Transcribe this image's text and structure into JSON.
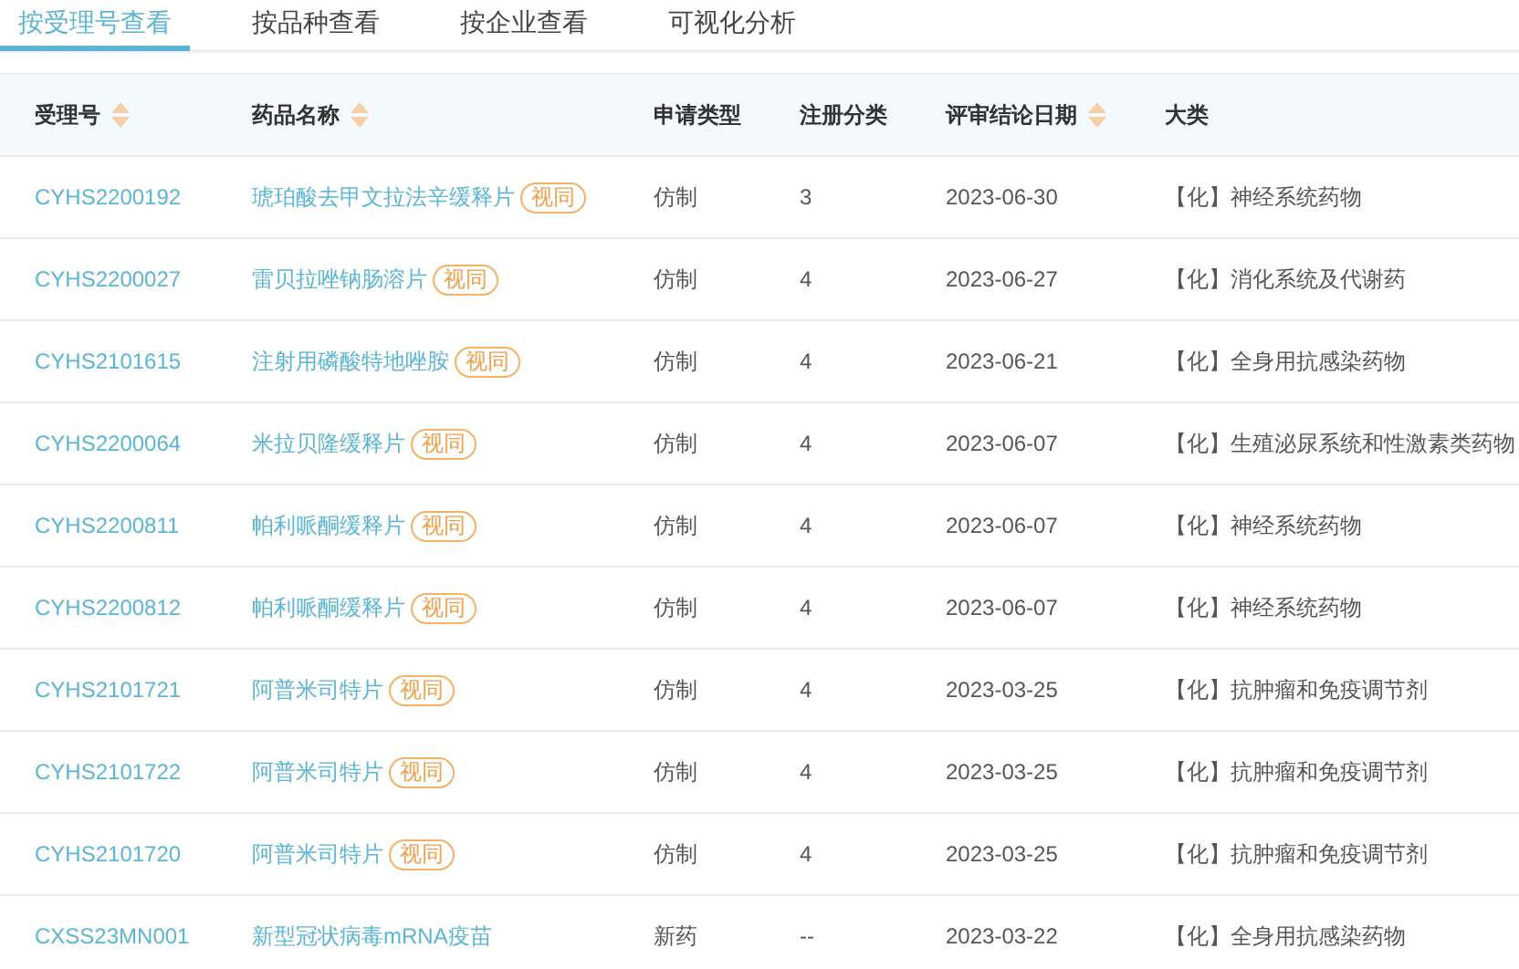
{
  "tabs": [
    {
      "label": "按受理号查看",
      "selected": true
    },
    {
      "label": "按品种查看",
      "selected": false
    },
    {
      "label": "按企业查看",
      "selected": false
    },
    {
      "label": "可视化分析",
      "selected": false
    }
  ],
  "table": {
    "columns": [
      {
        "label": "受理号",
        "sortable": true
      },
      {
        "label": "药品名称",
        "sortable": true
      },
      {
        "label": "申请类型",
        "sortable": false
      },
      {
        "label": "注册分类",
        "sortable": false
      },
      {
        "label": "评审结论日期",
        "sortable": true
      },
      {
        "label": "大类",
        "sortable": false
      }
    ],
    "rows": [
      {
        "id": "CYHS2200192",
        "name": "琥珀酸去甲文拉法辛缓释片",
        "tag": "视同",
        "type": "仿制",
        "class": "3",
        "date": "2023-06-30",
        "category": "【化】神经系统药物"
      },
      {
        "id": "CYHS2200027",
        "name": "雷贝拉唑钠肠溶片",
        "tag": "视同",
        "type": "仿制",
        "class": "4",
        "date": "2023-06-27",
        "category": "【化】消化系统及代谢药"
      },
      {
        "id": "CYHS2101615",
        "name": "注射用磷酸特地唑胺",
        "tag": "视同",
        "type": "仿制",
        "class": "4",
        "date": "2023-06-21",
        "category": "【化】全身用抗感染药物"
      },
      {
        "id": "CYHS2200064",
        "name": "米拉贝隆缓释片",
        "tag": "视同",
        "type": "仿制",
        "class": "4",
        "date": "2023-06-07",
        "category": "【化】生殖泌尿系统和性激素类药物"
      },
      {
        "id": "CYHS2200811",
        "name": "帕利哌酮缓释片",
        "tag": "视同",
        "type": "仿制",
        "class": "4",
        "date": "2023-06-07",
        "category": "【化】神经系统药物"
      },
      {
        "id": "CYHS2200812",
        "name": "帕利哌酮缓释片",
        "tag": "视同",
        "type": "仿制",
        "class": "4",
        "date": "2023-06-07",
        "category": "【化】神经系统药物"
      },
      {
        "id": "CYHS2101721",
        "name": "阿普米司特片",
        "tag": "视同",
        "type": "仿制",
        "class": "4",
        "date": "2023-03-25",
        "category": "【化】抗肿瘤和免疫调节剂"
      },
      {
        "id": "CYHS2101722",
        "name": "阿普米司特片",
        "tag": "视同",
        "type": "仿制",
        "class": "4",
        "date": "2023-03-25",
        "category": "【化】抗肿瘤和免疫调节剂"
      },
      {
        "id": "CYHS2101720",
        "name": "阿普米司特片",
        "tag": "视同",
        "type": "仿制",
        "class": "4",
        "date": "2023-03-25",
        "category": "【化】抗肿瘤和免疫调节剂"
      },
      {
        "id": "CXSS23MN001",
        "name": "新型冠状病毒mRNA疫苗",
        "type": "新药",
        "class": "--",
        "date": "2023-03-22",
        "category": "【化】全身用抗感染药物"
      }
    ]
  }
}
